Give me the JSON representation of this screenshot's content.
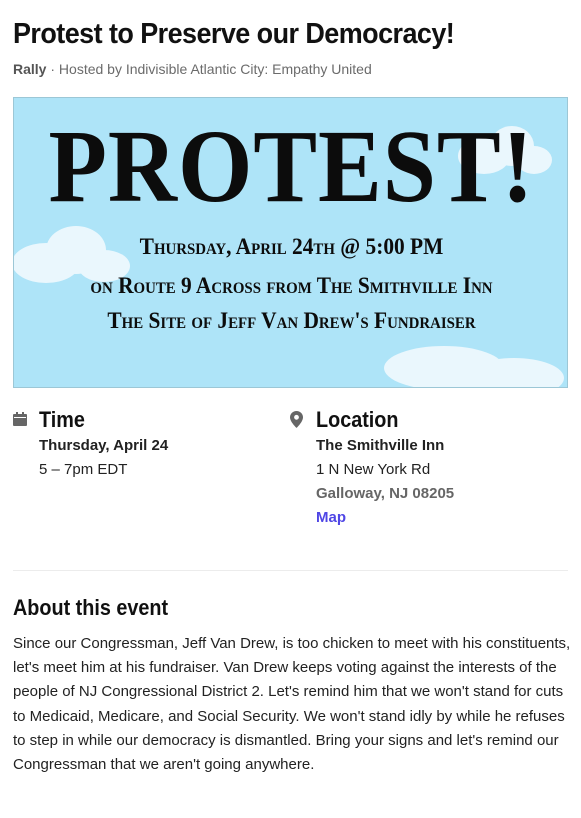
{
  "event": {
    "title": "Protest to Preserve our Democracy!",
    "type": "Rally",
    "separator": " · ",
    "host": "Hosted by Indivisible Atlantic City: Empathy United"
  },
  "banner": {
    "headline": "PROTEST!",
    "line1": "Thursday, April 24th @ 5:00 PM",
    "line2": "on Route 9 Across from The Smithville Inn",
    "line3": "The Site of Jeff Van Drew's Fundraiser",
    "background": "#aee4f8"
  },
  "time": {
    "heading": "Time",
    "icon": "calendar-icon",
    "date": "Thursday, April 24",
    "hours": "5 – 7pm EDT"
  },
  "location": {
    "heading": "Location",
    "icon": "map-pin-icon",
    "venue": "The Smithville Inn",
    "street": "1 N New York Rd",
    "city": "Galloway, NJ 08205",
    "map_label": "Map",
    "link_color": "#4f46e5"
  },
  "about": {
    "heading": "About this event",
    "body": "Since our Congressman, Jeff Van Drew, is too chicken to meet with his constituents, let's meet him at his fundraiser. Van Drew keeps voting against the interests of the people of NJ Congressional District 2. Let's remind him that we won't stand for cuts to Medicaid, Medicare, and Social Security. We won't stand idly by while he refuses to step in while our democracy is dismantled. Bring your signs and let's remind our Congressman that we aren't going anywhere."
  }
}
